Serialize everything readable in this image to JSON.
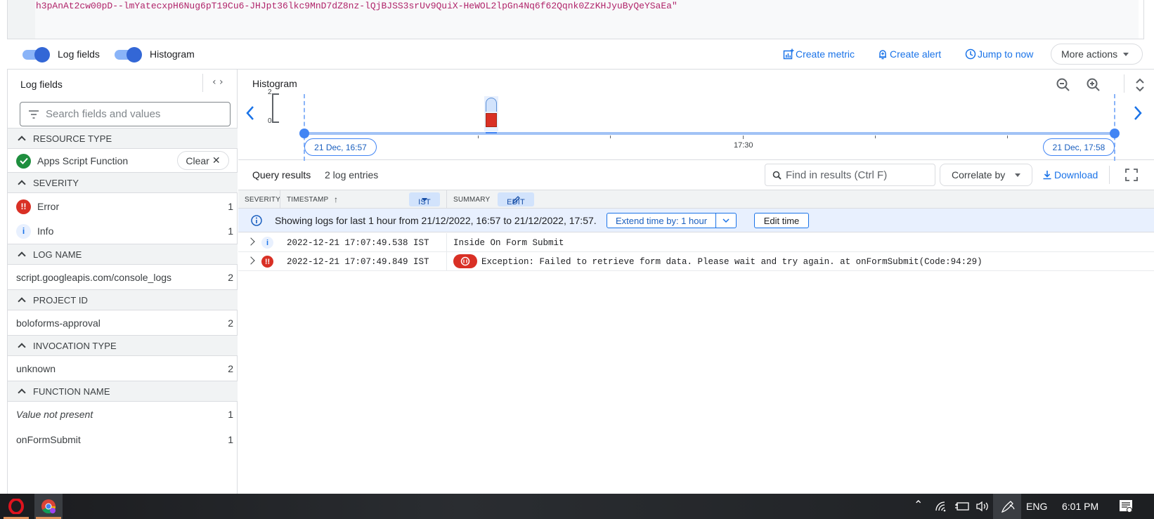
{
  "query": {
    "text": "h3pAnAt2cw00pD--lmYatecxpH6Nug6pT19Cu6-JHJpt36lkc9MnD7dZ8nz-lQjBJSS3srUv9QuiX-HeWOL2lpGn4Nq6f62Qqnk0ZzKHJyuByQeYSaEa\""
  },
  "toolbar": {
    "log_fields_label": "Log fields",
    "log_fields_on": true,
    "histogram_label": "Histogram",
    "histogram_on": true,
    "create_metric": "Create metric",
    "create_alert": "Create alert",
    "jump_to_now": "Jump to now",
    "more_actions": "More actions"
  },
  "sidebar": {
    "title": "Log fields",
    "search_placeholder": "Search fields and values",
    "sections": [
      {
        "title": "RESOURCE TYPE",
        "items": [
          {
            "label": "Apps Script Function",
            "status": "selected",
            "action": "Clear"
          }
        ]
      },
      {
        "title": "SEVERITY",
        "items": [
          {
            "label": "Error",
            "count": "1",
            "icon": "error-icon"
          },
          {
            "label": "Info",
            "count": "1",
            "icon": "info-icon"
          }
        ]
      },
      {
        "title": "LOG NAME",
        "items": [
          {
            "label": "script.googleapis.com/console_logs",
            "count": "2"
          }
        ]
      },
      {
        "title": "PROJECT ID",
        "items": [
          {
            "label": "boloforms-approval",
            "count": "2"
          }
        ]
      },
      {
        "title": "INVOCATION TYPE",
        "items": [
          {
            "label": "unknown",
            "count": "2"
          }
        ]
      },
      {
        "title": "FUNCTION NAME",
        "items": [
          {
            "label": "Value not present",
            "count": "1"
          },
          {
            "label": "onFormSubmit",
            "count": "1"
          }
        ]
      }
    ]
  },
  "histogram": {
    "title": "Histogram",
    "y_max_label": "2",
    "y_min_label": "0",
    "start_label": "21 Dec, 16:57",
    "mid_label": "17:30",
    "end_label": "21 Dec, 17:58",
    "colors": {
      "info": "#d2e3fc",
      "error": "#d93025",
      "accent": "#4285f4"
    }
  },
  "chart_data": {
    "type": "bar",
    "title": "Histogram",
    "x_range": [
      "21 Dec, 16:57",
      "21 Dec, 17:58"
    ],
    "tick_labels": [
      "17:30"
    ],
    "ylim": [
      0,
      2
    ],
    "categories": [
      "17:07"
    ],
    "series": [
      {
        "name": "Error",
        "values": [
          1
        ]
      },
      {
        "name": "Info",
        "values": [
          1
        ]
      }
    ]
  },
  "results": {
    "title": "Query results",
    "count": "2 log entries",
    "find_placeholder": "Find in results (Ctrl F)",
    "correlate_by": "Correlate by",
    "download": "Download",
    "columns": {
      "severity": "SEVERITY",
      "timestamp": "TIMESTAMP",
      "timezone": "IST",
      "summary": "SUMMARY",
      "edit": "EDIT"
    },
    "banner": {
      "text": "Showing logs for last 1 hour from 21/12/2022, 16:57 to 21/12/2022, 17:57.",
      "extend": "Extend time by: 1 hour",
      "edit_time": "Edit time"
    },
    "rows": [
      {
        "severity": "info",
        "timestamp": "2022-12-21 17:07:49.538 IST",
        "summary": "Inside On Form Submit"
      },
      {
        "severity": "error",
        "timestamp": "2022-12-21 17:07:49.849 IST",
        "summary": "Exception: Failed to retrieve form data. Please wait and try again. at onFormSubmit(Code:94:29)"
      }
    ]
  },
  "taskbar": {
    "apps": [
      "opera-browser",
      "chrome-browser"
    ],
    "language": "ENG",
    "time": "6:01 PM"
  }
}
